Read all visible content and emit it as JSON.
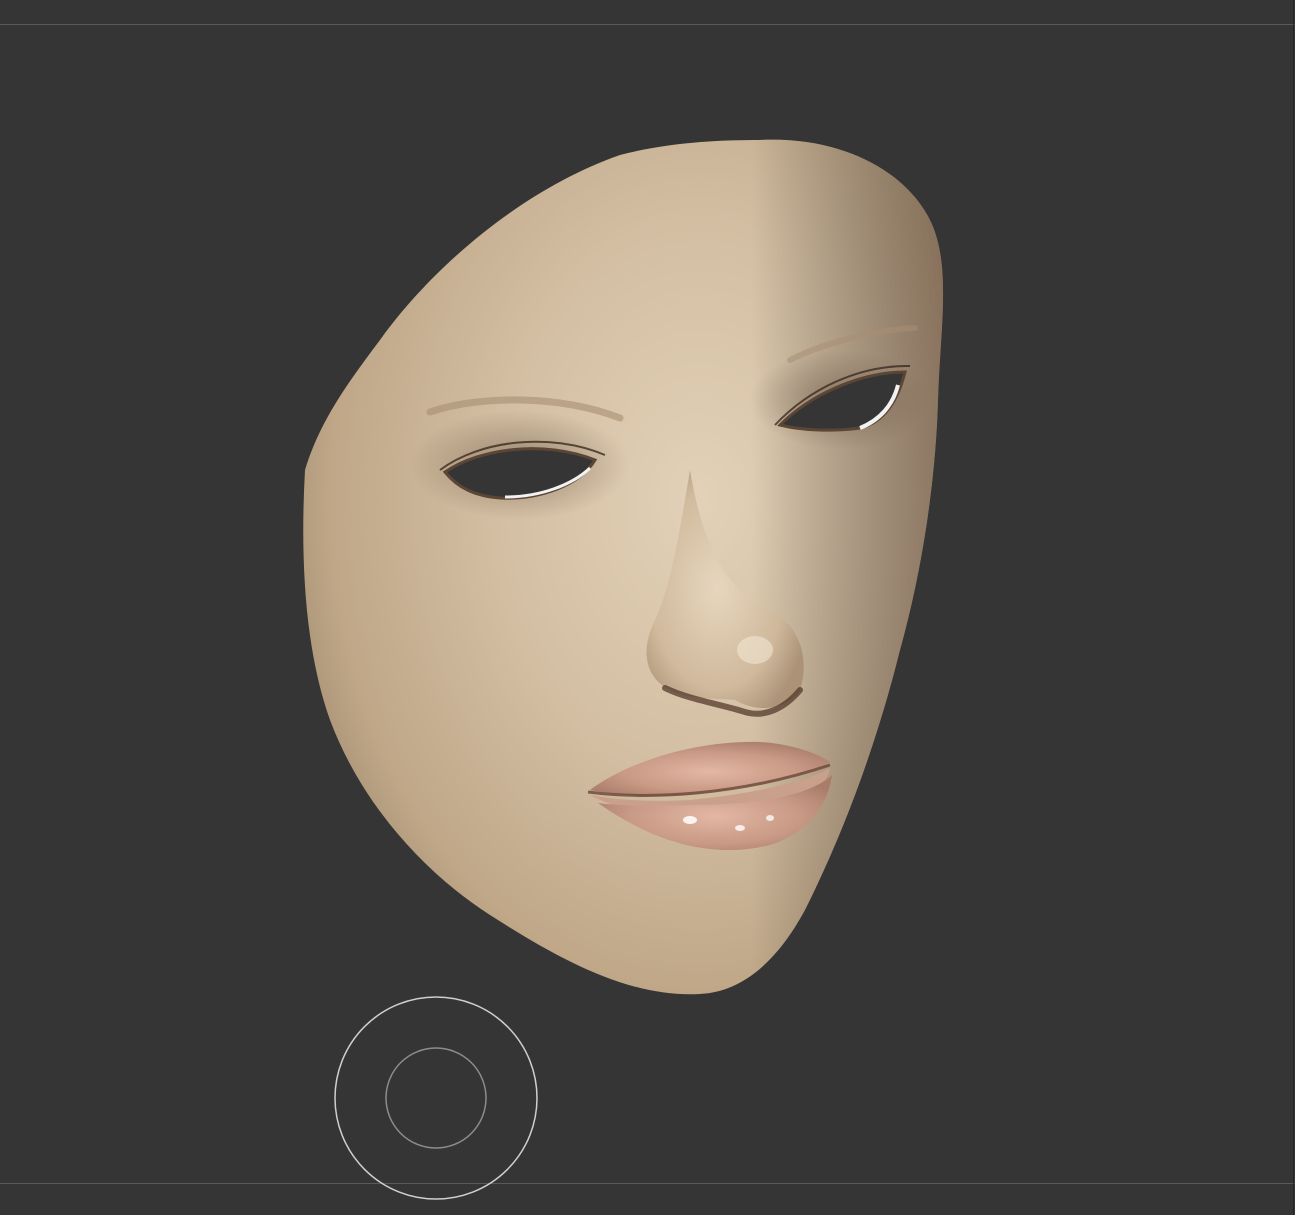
{
  "viewport": {
    "background_color": "#353535",
    "frame_line_color": "#5a5a5a"
  },
  "model": {
    "skin_base_color": "#d6c2a6",
    "skin_shadow_color": "#8a7560",
    "lip_color": "#c99a86"
  },
  "brush_cursor": {
    "icon": "brush-cursor-icon",
    "ring_color": "#c8c8c8",
    "inner_ring_color": "#8a8a8a"
  }
}
